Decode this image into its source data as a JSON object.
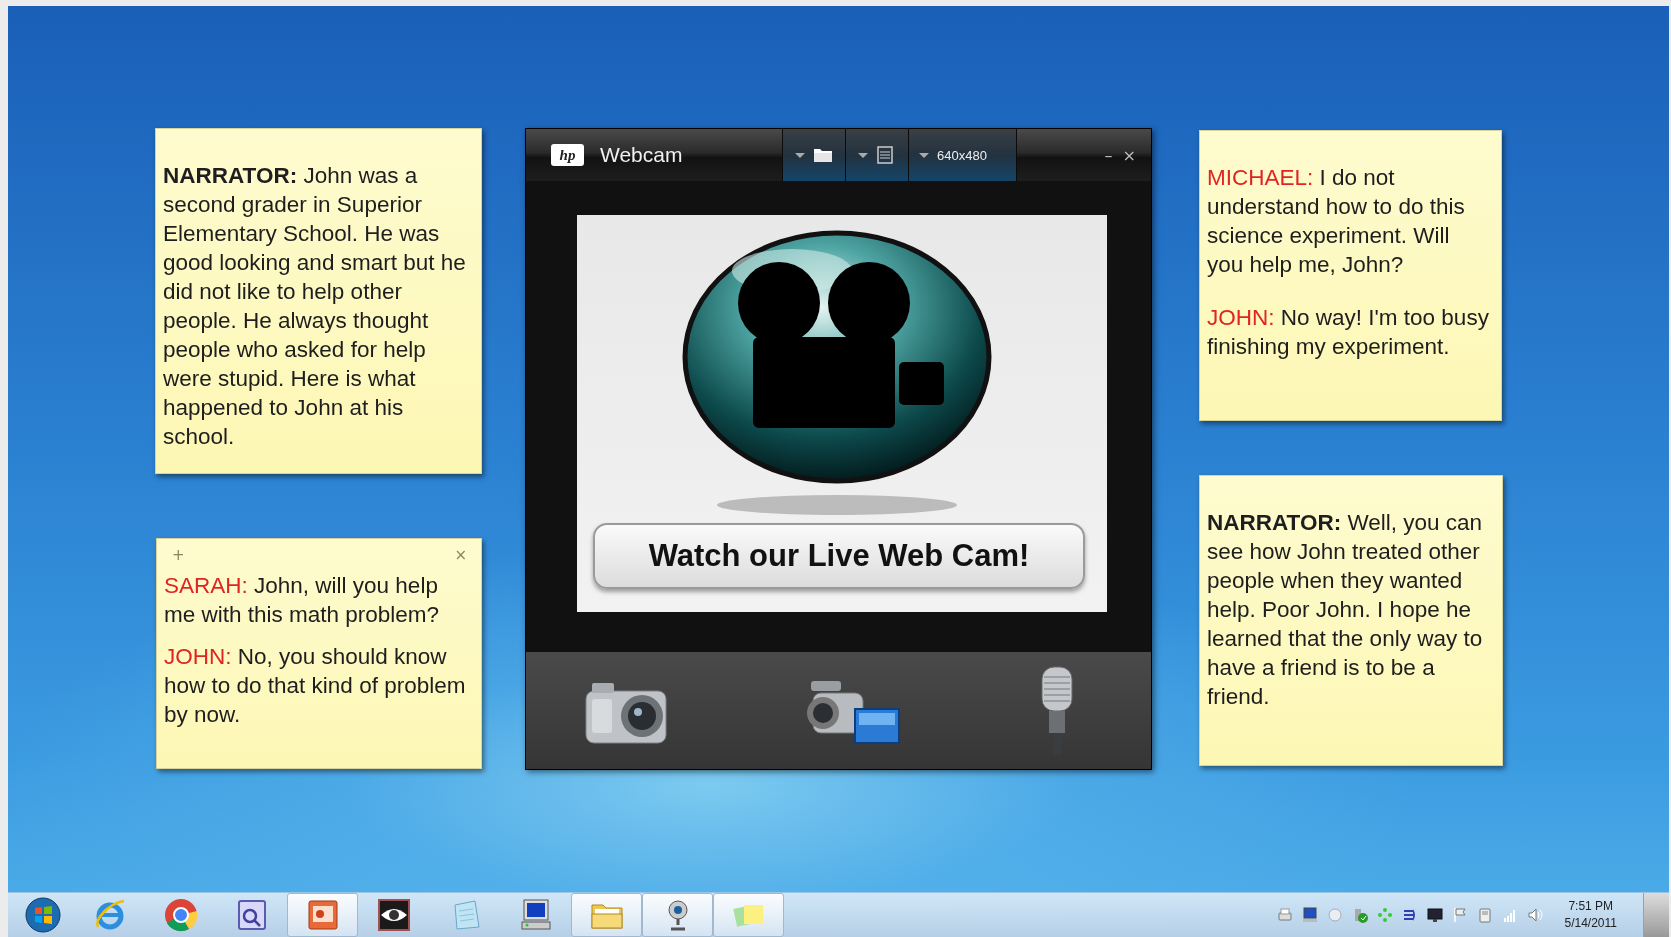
{
  "notes": [
    {
      "paragraphs": [
        {
          "speaker": "NARRATOR:",
          "kind": "narrator",
          "text": " John was a second grader in Superior Elementary School. He was good looking and smart but he did not like to help other people. He always thought people who asked for help were stupid. Here is what happened to John at his school."
        }
      ]
    },
    {
      "controls": {
        "add": "+",
        "close": "×"
      },
      "paragraphs": [
        {
          "speaker": "SARAH:",
          "kind": "character",
          "text": " John, will you help me with this math problem?"
        },
        {
          "speaker": "JOHN:",
          "kind": "character",
          "text": " No, you should know how to do that kind of problem by now."
        }
      ]
    },
    {
      "paragraphs": [
        {
          "speaker": "MICHAEL:",
          "kind": "character",
          "text": " I do not understand how to do this science experiment. Will you help me, John?"
        },
        {
          "speaker": "JOHN:",
          "kind": "character",
          "text": " No way! I'm too busy finishing my experiment."
        }
      ]
    },
    {
      "paragraphs": [
        {
          "speaker": "NARRATOR:",
          "kind": "narrator",
          "text": " Well, you can see how John treated other people when they wanted help. Poor John. I hope he learned that the only way to have a friend is to be a friend."
        }
      ]
    }
  ],
  "webcam": {
    "logo": "hp",
    "title": "Webcam",
    "toolbar": [
      {
        "kind": "folder"
      },
      {
        "kind": "file"
      },
      {
        "kind": "resolution",
        "label": "640x480"
      }
    ],
    "minimize": "–",
    "close": "×",
    "banner": "Watch our Live Web Cam!",
    "actions": [
      {
        "kind": "photo"
      },
      {
        "kind": "video"
      },
      {
        "kind": "audio"
      }
    ]
  },
  "taskbar": {
    "buttons": [
      {
        "kind": "start",
        "running": false
      },
      {
        "kind": "e-logo",
        "running": false
      },
      {
        "kind": "round-logo",
        "running": false
      },
      {
        "kind": "document",
        "running": false
      },
      {
        "kind": "slides",
        "running": true
      },
      {
        "kind": "eye",
        "running": false
      },
      {
        "kind": "notepad",
        "running": false
      },
      {
        "kind": "computer",
        "running": false
      },
      {
        "kind": "folder",
        "running": true
      },
      {
        "kind": "webcam",
        "running": true
      },
      {
        "kind": "notes",
        "running": true
      }
    ],
    "clock": {
      "time": "7:51 PM",
      "date": "5/14/2011"
    }
  }
}
